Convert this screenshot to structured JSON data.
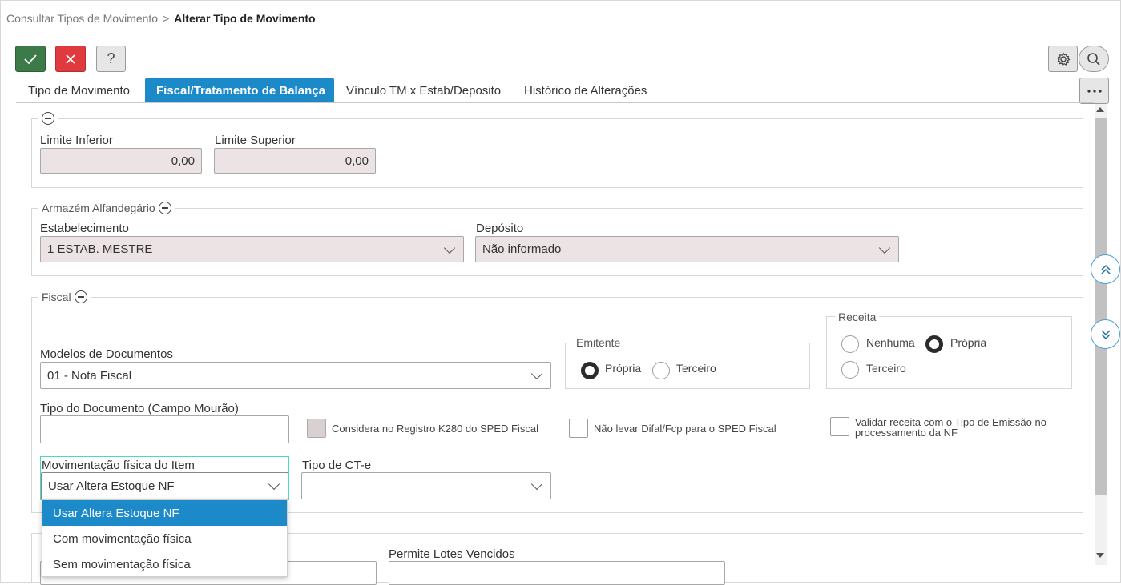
{
  "breadcrumb": {
    "parent": "Consultar Tipos de Movimento",
    "separator": ">",
    "current": "Alterar Tipo de Movimento"
  },
  "toolbar": {
    "help_label": "?"
  },
  "tabs": [
    {
      "label": "Tipo de Movimento"
    },
    {
      "label": "Fiscal/Tratamento de Balança"
    },
    {
      "label": "Vínculo TM x Estab/Deposito"
    },
    {
      "label": "Histórico de Alterações"
    }
  ],
  "limites": {
    "inferior_label": "Limite Inferior",
    "inferior_value": "0,00",
    "superior_label": "Limite Superior",
    "superior_value": "0,00"
  },
  "armazem": {
    "legend": "Armazém Alfandegário",
    "estab_label": "Estabelecimento",
    "estab_value": "1 ESTAB. MESTRE",
    "deposito_label": "Depósito",
    "deposito_value": "Não informado"
  },
  "fiscal": {
    "legend": "Fiscal",
    "modelos_label": "Modelos de Documentos",
    "modelos_value": "01 - Nota Fiscal",
    "emitente_legend": "Emitente",
    "emitente_opt1": "Própria",
    "emitente_opt2": "Terceiro",
    "receita_legend": "Receita",
    "receita_opt1": "Nenhuma",
    "receita_opt2": "Própria",
    "receita_opt3": "Terceiro",
    "tipo_doc_label": "Tipo do Documento (Campo Mourão)",
    "tipo_doc_value": "",
    "chk_k280": "Considera no Registro K280 do SPED Fiscal",
    "chk_difal": "Não levar Difal/Fcp para o SPED Fiscal",
    "chk_validar": "Validar receita com o Tipo de Emissão no processamento da NF",
    "mov_label": "Movimentação física do Item",
    "mov_value": "Usar Altera Estoque NF",
    "cte_label": "Tipo de CT-e",
    "cte_value": ""
  },
  "lower": {
    "lotes_label": "Permite Lotes Vencidos"
  },
  "dropdown": {
    "options": [
      "Usar Altera Estoque NF",
      "Com movimentação física",
      "Sem movimentação física"
    ]
  },
  "colors": {
    "accent": "#1c8ac9",
    "ok": "#3c7a4a",
    "cancel": "#e0393e"
  }
}
